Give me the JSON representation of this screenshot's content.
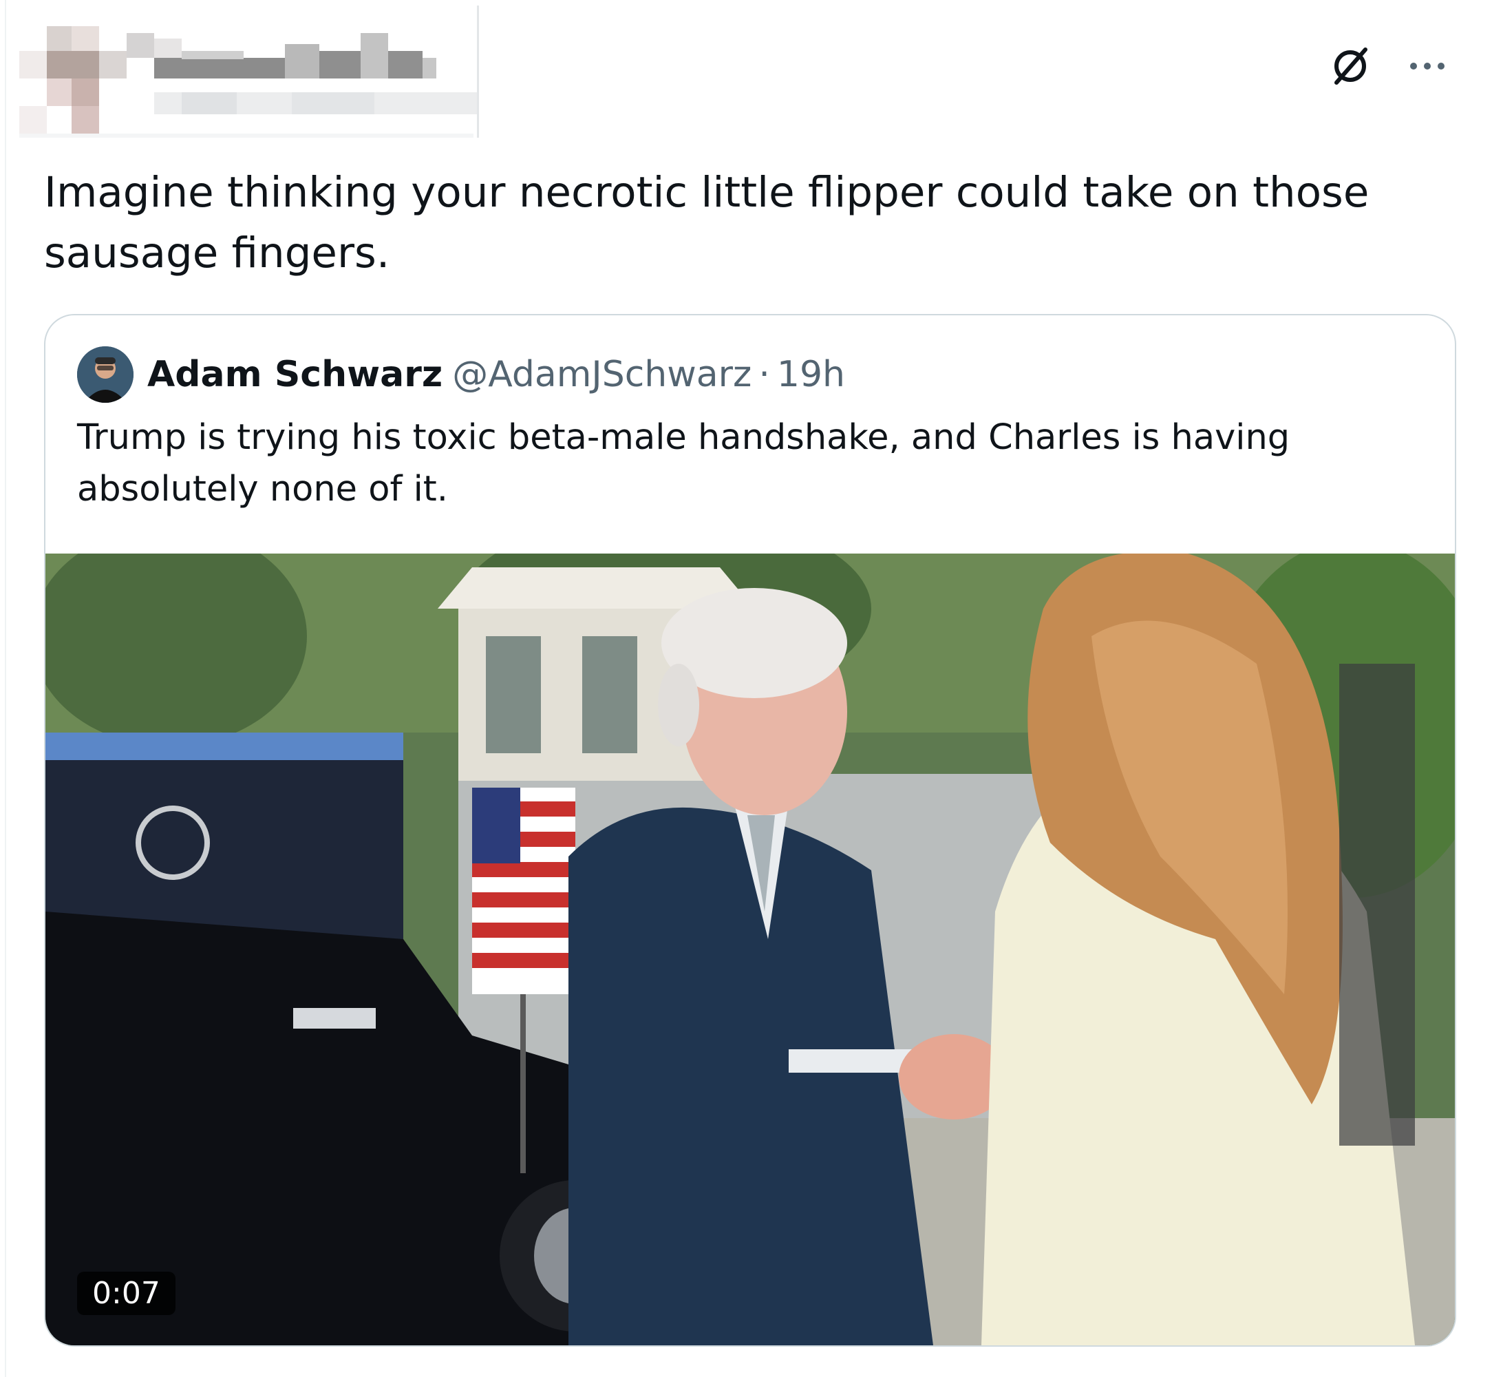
{
  "header": {
    "grok_icon": "grok-slash-circle-icon",
    "more_icon": "more-dots-icon"
  },
  "post": {
    "text": "Imagine thinking your necrotic little flipper could take on those sausage fingers."
  },
  "quote": {
    "author_name": "Adam Schwarz",
    "author_handle": "@AdamJSchwarz",
    "separator": "·",
    "time": "19h",
    "text": "Trump is trying his toxic beta-male handshake, and Charles is having absolutely none of it.",
    "video": {
      "duration": "0:07"
    }
  },
  "colors": {
    "text_primary": "#0f1419",
    "text_secondary": "#536471",
    "border": "#cfd9de"
  }
}
